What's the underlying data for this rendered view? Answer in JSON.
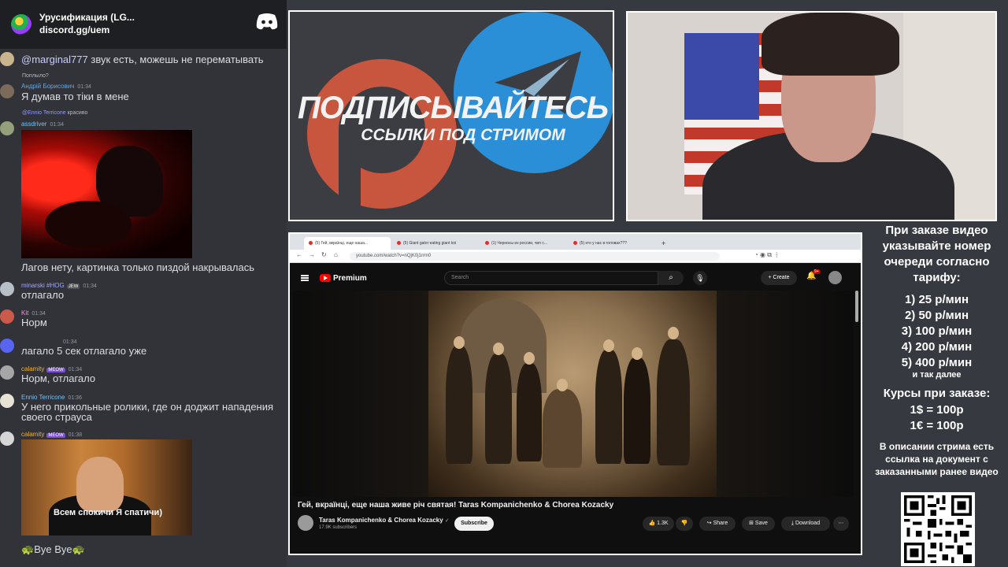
{
  "discord": {
    "server_name": "Урусификация (LG...",
    "invite": "discord.gg/uem",
    "messages": [
      {
        "id": "m1",
        "user": "",
        "time": "",
        "text_mention": "@marginal777",
        "text": " звук есть, можешь не перематывать"
      },
      {
        "id": "m2",
        "reply": "Поплыло?",
        "user": "Андрій Борисович",
        "time": "01:34",
        "text": "Я думав то тіки в мене"
      },
      {
        "id": "m3",
        "reply_name": "@Ennio Terricone",
        "reply": "красиво",
        "user": "assdriver",
        "time": "01:34",
        "text": "Лагов нету, картинка только пиздой накрывалась"
      },
      {
        "id": "m4",
        "user": "minarski #HOG",
        "tag": "JEW",
        "time": "01:34",
        "text": "отлагало"
      },
      {
        "id": "m5",
        "user": "Kit",
        "time": "01:34",
        "text": "Норм"
      },
      {
        "id": "m6",
        "user": "",
        "time": "01:34",
        "text": "лагало 5 сек отлагало уже"
      },
      {
        "id": "m7",
        "user": "calamity",
        "tag": "MEOW",
        "time": "01:34",
        "text": "Норм, отлагало"
      },
      {
        "id": "m8",
        "user": "Ennio Terricone",
        "time": "01:36",
        "text": "У него прикольные ролики, где он доджит нападения своего страуса"
      },
      {
        "id": "m9",
        "user": "calamity",
        "tag": "MEOW",
        "time": "01:38",
        "text": "Bye Bye"
      }
    ],
    "cam_caption": "Всем спокичи Я спатичи)"
  },
  "banner": {
    "line1": "ПОДПИСЫВАЙТЕСЬ",
    "line2": "ССЫЛКИ ПОД СТРИМОМ"
  },
  "browser": {
    "tabs": [
      "(5) Гей, вкраїнці, еще наша...",
      "(5) Giant gator eating giant koi",
      "(1) Черносы из россии, чип с...",
      "(5) кто у нас в головах???"
    ],
    "url": "youtube.com/watch?v=nQjK0j1rrm0"
  },
  "youtube": {
    "brand": "Premium",
    "search_placeholder": "Search",
    "create_label": "Create",
    "notif_count": "9+",
    "video_title": "Гей, вкраїнці, еще наша живе річ святая! Taras Kompanichenko & Chorea Kozacky",
    "channel": "Taras Kompanichenko & Chorea Kozacky",
    "subscribers": "17.9K subscribers",
    "subscribe_label": "Subscribe",
    "likes": "1.3K",
    "share_label": "Share",
    "save_label": "Save",
    "download_label": "Download"
  },
  "info": {
    "intro": "При заказе видео указывайте номер очереди согласно тарифу:",
    "tariffs": [
      "1) 25 р/мин",
      "2) 50 р/мин",
      "3) 100 р/мин",
      "4) 200 р/мин",
      "5) 400 р/мин"
    ],
    "tariff_note": "и так далее",
    "rates_title": "Курсы при заказе:",
    "rates": [
      "1$ = 100р",
      "1€ = 100р"
    ],
    "description": "В описании стрима есть ссылка на документ с заказанными ранее видео"
  }
}
